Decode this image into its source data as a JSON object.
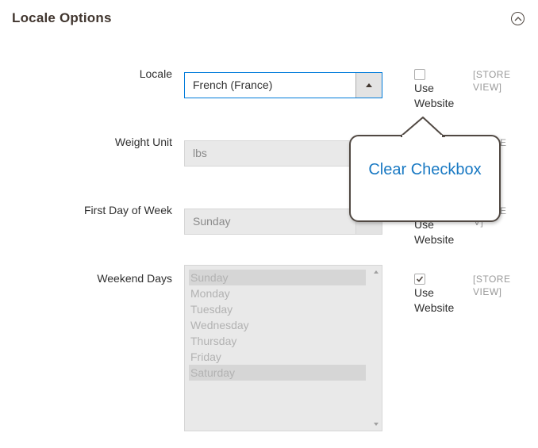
{
  "section": {
    "title": "Locale Options"
  },
  "locale": {
    "label": "Locale",
    "value": "French (France)",
    "use_website_label": "Use Website",
    "use_website_checked": false,
    "scope": "[STORE VIEW]"
  },
  "weight_unit": {
    "label": "Weight Unit",
    "value": "lbs",
    "scope_fragment": "E"
  },
  "first_day": {
    "label": "First Day of Week",
    "value": "Sunday",
    "use_website_label": "Use Website",
    "scope_fragment_1": "E",
    "scope_fragment_2": "V]"
  },
  "weekend_days": {
    "label": "Weekend Days",
    "options": [
      {
        "label": "Sunday",
        "selected": true
      },
      {
        "label": "Monday",
        "selected": false
      },
      {
        "label": "Tuesday",
        "selected": false
      },
      {
        "label": "Wednesday",
        "selected": false
      },
      {
        "label": "Thursday",
        "selected": false
      },
      {
        "label": "Friday",
        "selected": false
      },
      {
        "label": "Saturday",
        "selected": true
      }
    ],
    "use_website_label": "Use Website",
    "use_website_checked": true,
    "scope": "[STORE VIEW]"
  },
  "callout": {
    "text": "Clear Checkbox"
  },
  "colors": {
    "title": "#41362f",
    "focus_border": "#007bdb",
    "callout_text": "#1979c3",
    "disabled_bg": "#e9e9e9"
  },
  "icons": {
    "collapse": "chevron-up-circle-icon",
    "select_arrow": "triangle-up-icon",
    "checkmark": "checkmark-icon"
  }
}
